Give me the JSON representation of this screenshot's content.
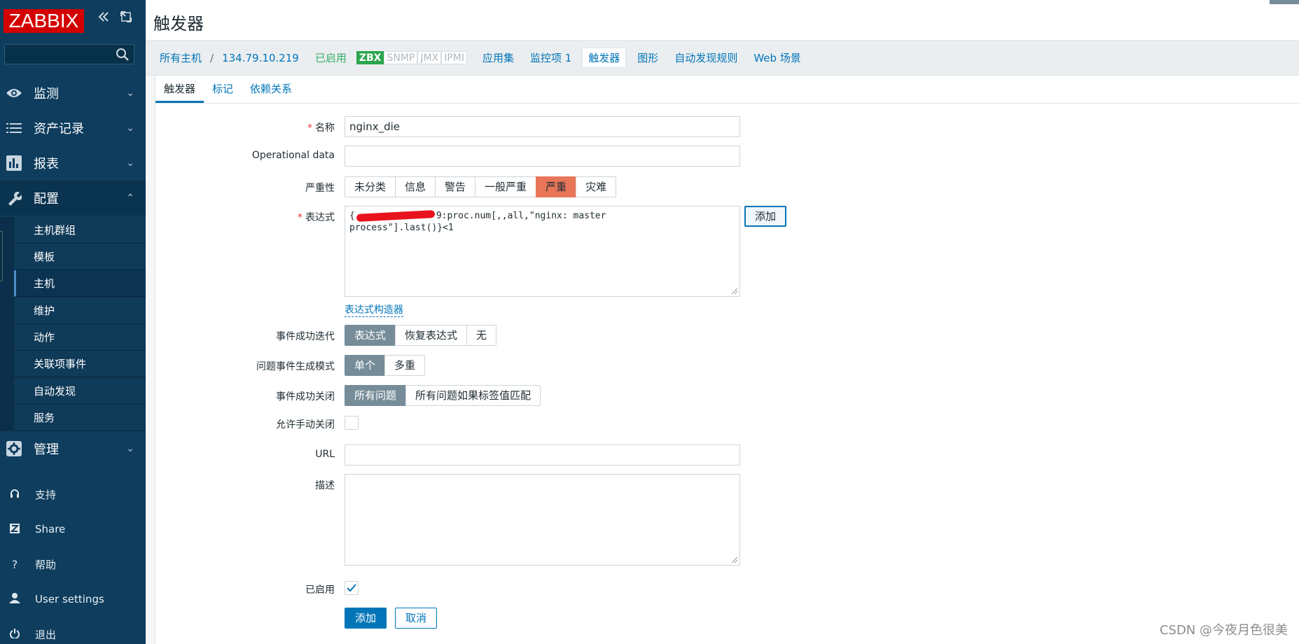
{
  "sidebar": {
    "logo": "ZABBIX",
    "search_placeholder": "",
    "sections": [
      {
        "label": "监测",
        "icon": "eye-icon"
      },
      {
        "label": "资产记录",
        "icon": "list-icon"
      },
      {
        "label": "报表",
        "icon": "bar-chart-icon"
      },
      {
        "label": "配置",
        "icon": "wrench-icon"
      },
      {
        "label": "管理",
        "icon": "gear-icon"
      }
    ],
    "config_items": [
      "主机群组",
      "模板",
      "主机",
      "维护",
      "动作",
      "关联项事件",
      "自动发现",
      "服务"
    ],
    "active_item": "主机",
    "footer": [
      {
        "label": "支持",
        "icon": "headset-icon"
      },
      {
        "label": "Share",
        "icon": "share-z-icon"
      },
      {
        "label": "帮助",
        "icon": "help-icon"
      },
      {
        "label": "User settings",
        "icon": "user-icon"
      },
      {
        "label": "退出",
        "icon": "power-icon"
      }
    ]
  },
  "header": {
    "title": "触发器"
  },
  "nav": {
    "all_hosts": "所有主机",
    "separator": "/",
    "host": "134.79.10.219",
    "status": "已启用",
    "interfaces": [
      {
        "label": "ZBX",
        "active": true
      },
      {
        "label": "SNMP",
        "active": false
      },
      {
        "label": "JMX",
        "active": false
      },
      {
        "label": "IPMI",
        "active": false
      }
    ],
    "links": [
      "应用集",
      "监控项 1",
      "触发器",
      "图形",
      "自动发现规则",
      "Web 场景"
    ],
    "active_link": "触发器"
  },
  "tabs": [
    "触发器",
    "标记",
    "依赖关系"
  ],
  "form": {
    "name_label": "名称",
    "name_value": "nginx_die",
    "opdata_label": "Operational data",
    "opdata_value": "",
    "severity_label": "严重性",
    "severities": [
      "未分类",
      "信息",
      "警告",
      "一般严重",
      "严重",
      "灾难"
    ],
    "severity_selected": "严重",
    "expression_label": "表达式",
    "expression_prefix": "{",
    "expression_line1": "9:proc.num[,,all,\"nginx: master",
    "expression_line2": "process\"].last()}<1",
    "add_expression_button": "添加",
    "expression_builder_link": "表达式构造器",
    "ok_event_label": "事件成功迭代",
    "ok_event_options": [
      "表达式",
      "恢复表达式",
      "无"
    ],
    "ok_event_selected": "表达式",
    "problem_mode_label": "问题事件生成模式",
    "problem_mode_options": [
      "单个",
      "多重"
    ],
    "problem_mode_selected": "单个",
    "ok_close_label": "事件成功关闭",
    "ok_close_options": [
      "所有问题",
      "所有问题如果标签值匹配"
    ],
    "ok_close_selected": "所有问题",
    "manual_close_label": "允许手动关闭",
    "manual_close_checked": false,
    "url_label": "URL",
    "url_value": "",
    "description_label": "描述",
    "description_value": "",
    "enabled_label": "已启用",
    "enabled_checked": true,
    "submit_button": "添加",
    "cancel_button": "取消"
  },
  "watermark": "CSDN @今夜月色很美",
  "colors": {
    "sidebar_bg": "#0e3d5e",
    "logo_red": "#d40000",
    "link_blue": "#0275b8",
    "enabled_green": "#34af67",
    "severity_high": "#e97659",
    "selected_gray": "#768d99"
  }
}
